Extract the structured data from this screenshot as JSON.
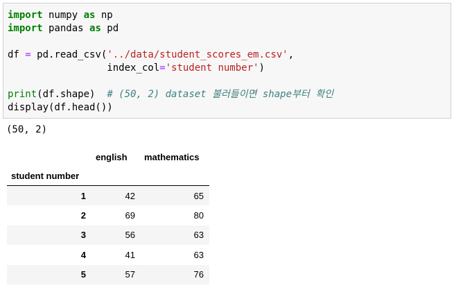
{
  "code": {
    "line1": {
      "kw": "import",
      "mod": " numpy ",
      "as": "as",
      "alias": " np"
    },
    "line2": {
      "kw": "import",
      "mod": " pandas ",
      "as": "as",
      "alias": " pd"
    },
    "line4": {
      "pre": "df ",
      "op": "=",
      "mid": " pd.read_csv(",
      "str": "'../data/student_scores_em.csv'",
      "post": ","
    },
    "line5": {
      "pre": "                 index_col",
      "op": "=",
      "str": "'student number'",
      "post": ")"
    },
    "line7": {
      "fn": "print",
      "arg": "(df.shape)  ",
      "comment": "# (50, 2) dataset 불러들이면 shape부터 확인"
    },
    "line8": {
      "text": "display(df.head())"
    }
  },
  "output": {
    "shape": "(50, 2)"
  },
  "table": {
    "columns": [
      "english",
      "mathematics"
    ],
    "index_name": "student number",
    "rows": [
      {
        "index": "1",
        "english": "42",
        "mathematics": "65"
      },
      {
        "index": "2",
        "english": "69",
        "mathematics": "80"
      },
      {
        "index": "3",
        "english": "56",
        "mathematics": "63"
      },
      {
        "index": "4",
        "english": "41",
        "mathematics": "63"
      },
      {
        "index": "5",
        "english": "57",
        "mathematics": "76"
      }
    ]
  }
}
